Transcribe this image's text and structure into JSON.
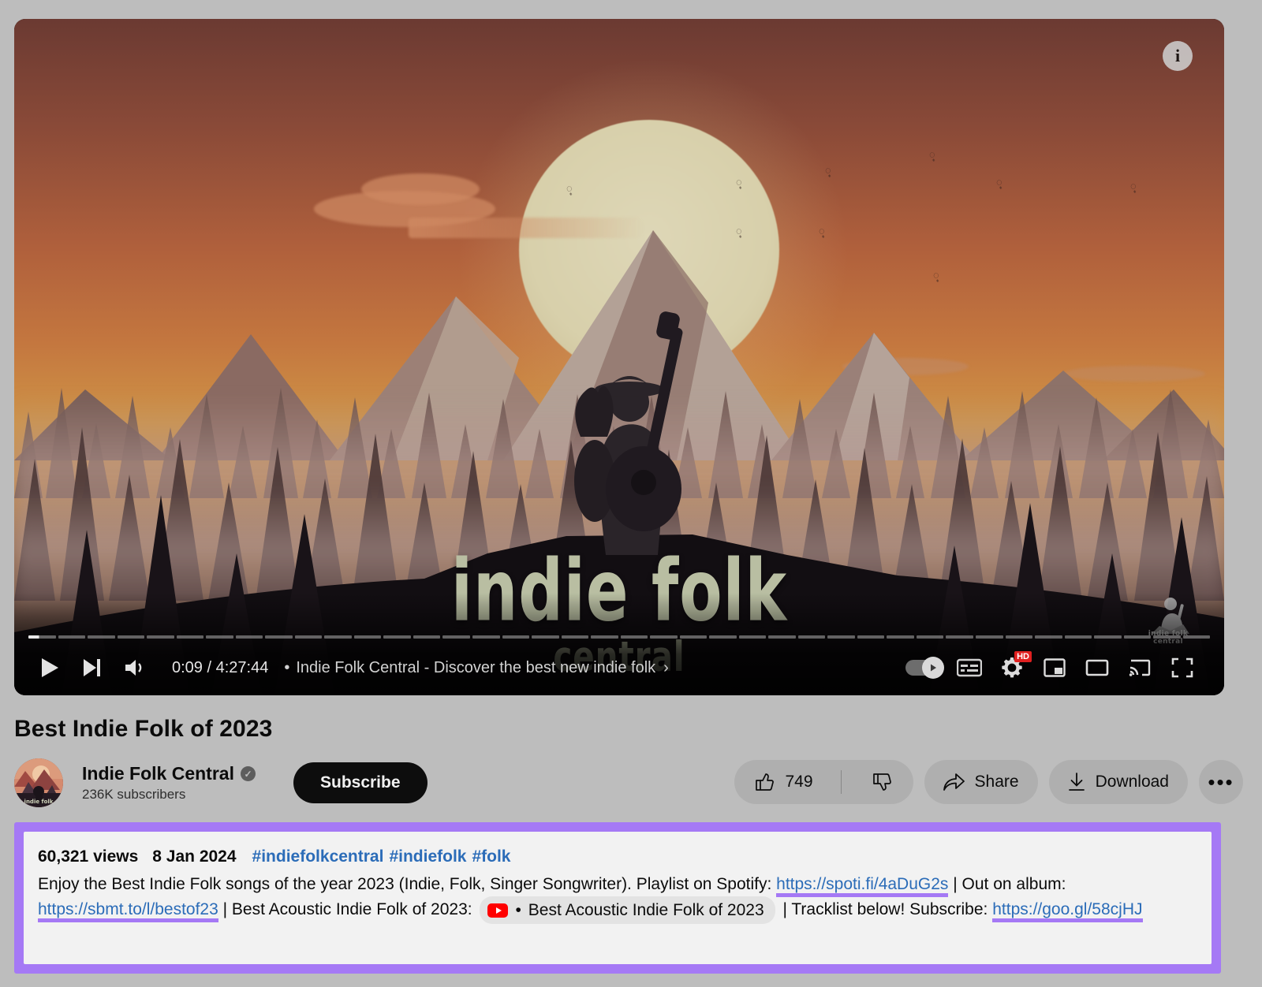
{
  "player": {
    "info_icon": "info-icon",
    "current_time": "0:09",
    "duration": "4:27:44",
    "separator": "•",
    "now_playing_title": "Indie Folk Central - Discover the best new indie folk",
    "expand_chevron": "›",
    "quality_badge": "HD",
    "logo_main": "indie folk",
    "logo_sub": "central",
    "watermark_label": "indie folk central",
    "controls": [
      {
        "name": "play-button",
        "label": "Play"
      },
      {
        "name": "next-button",
        "label": "Next"
      },
      {
        "name": "volume-button",
        "label": "Mute"
      },
      {
        "name": "autoplay-toggle",
        "label": "Autoplay"
      },
      {
        "name": "subtitles-button",
        "label": "Subtitles"
      },
      {
        "name": "settings-button",
        "label": "Settings"
      },
      {
        "name": "miniplayer-button",
        "label": "Miniplayer"
      },
      {
        "name": "theater-button",
        "label": "Theater mode"
      },
      {
        "name": "cast-button",
        "label": "Play on TV"
      },
      {
        "name": "fullscreen-button",
        "label": "Full screen"
      }
    ]
  },
  "video": {
    "title": "Best Indie Folk of 2023"
  },
  "channel": {
    "name": "Indie Folk Central",
    "verified_glyph": "✓",
    "subscribers": "236K subscribers",
    "subscribe_label": "Subscribe"
  },
  "actions": {
    "like_count": "749",
    "dislike_label": "",
    "share_label": "Share",
    "download_label": "Download",
    "more_label": "•••"
  },
  "description": {
    "views": "60,321 views",
    "date": "8 Jan 2024",
    "hashtags": [
      "#indiefolkcentral",
      "#indiefolk",
      "#folk"
    ],
    "text_1": "Enjoy the Best Indie Folk songs of the year 2023 (Indie, Folk, Singer Songwriter). Playlist on Spotify: ",
    "link_spotify": "https://spoti.fi/4aDuG2s",
    "text_2": " | Out on album:",
    "link_album": "https://sbmt.to/l/bestof23",
    "text_3": " | Best Acoustic Indie Folk of 2023: ",
    "chip_bullet": "•",
    "chip_label": "Best Acoustic Indie Folk of 2023",
    "text_4": " | Tracklist below! Subscribe:",
    "link_subscribe": "https://goo.gl/58cjHJ"
  },
  "colors": {
    "highlight": "#a579f5",
    "link": "#2b6cb8",
    "page_bg": "#bdbdbd",
    "desc_bg": "#f2f2f2",
    "youtube_red": "#ff0000"
  }
}
